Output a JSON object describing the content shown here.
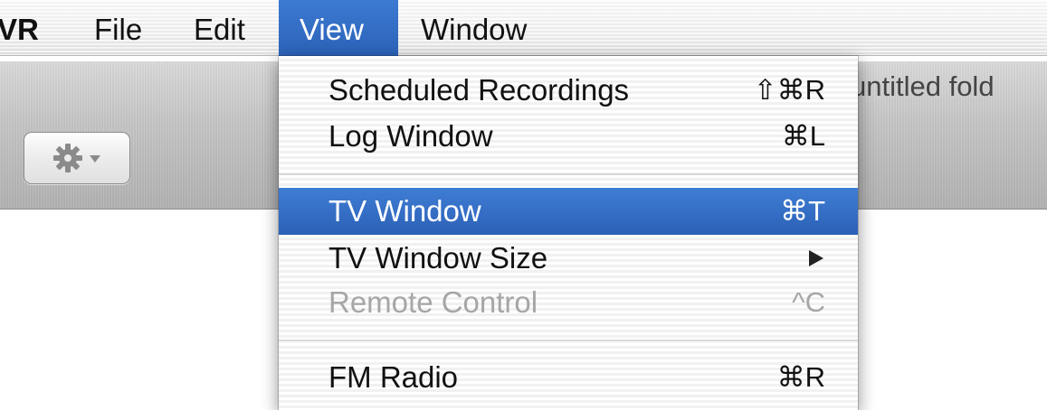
{
  "menubar": {
    "app_label": "VR",
    "file": "File",
    "edit": "Edit",
    "view": "View",
    "window": "Window",
    "highlight_color": "#2c62b8"
  },
  "window": {
    "folder_title": "untitled fold",
    "gear_icon": "gear-icon",
    "gear_menu_icon": "chevron-down-icon"
  },
  "view_menu": {
    "items": [
      {
        "label": "Scheduled Recordings",
        "shortcut": "⇧⌘R",
        "state": "normal"
      },
      {
        "label": "Log Window",
        "shortcut": "⌘L",
        "state": "normal"
      },
      {
        "label": "TV Window",
        "shortcut": "⌘T",
        "state": "highlighted"
      },
      {
        "label": "TV Window Size",
        "shortcut": "",
        "submenu_icon": "submenu-arrow-icon",
        "state": "normal"
      },
      {
        "label": "Remote Control",
        "shortcut": "^C",
        "state": "disabled"
      },
      {
        "label": "FM Radio",
        "shortcut": "⌘R",
        "state": "normal"
      }
    ]
  }
}
